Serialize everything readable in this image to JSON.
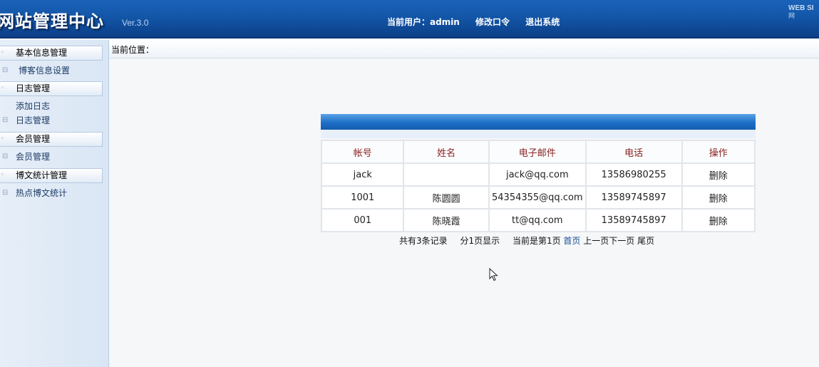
{
  "header": {
    "logo": "网站管理中心",
    "version": "Ver.3.0",
    "current_user_label": "当前用户：admin",
    "change_password": "修改口令",
    "logout": "退出系统",
    "brand_line1": "WEB SI",
    "brand_line2": "网"
  },
  "sidebar": {
    "sections": [
      {
        "title": "基本信息管理",
        "items": [
          "博客信息设置"
        ]
      },
      {
        "title": "日志管理",
        "items": [
          "添加日志",
          "日志管理"
        ]
      },
      {
        "title": "会员管理",
        "items": [
          "会员管理"
        ]
      },
      {
        "title": "博文统计管理",
        "items": [
          "热点博文统计"
        ]
      }
    ]
  },
  "location": {
    "label": "当前位置："
  },
  "table": {
    "headers": [
      "帐号",
      "姓名",
      "电子邮件",
      "电话",
      "操作"
    ],
    "rows": [
      [
        "jack",
        "",
        "jack@qq.com",
        "13586980255",
        "删除"
      ],
      [
        "1001",
        "陈圆圆",
        "54354355@qq.com",
        "13589745897",
        "删除"
      ],
      [
        "001",
        "陈晓霞",
        "tt@qq.com",
        "13589745897",
        "删除"
      ]
    ]
  },
  "pager": {
    "total": "共有3条记录",
    "pages": "分1页显示",
    "current": "当前是第1页",
    "first": "首页",
    "prev": "上一页",
    "next": "下一页",
    "last": "尾页"
  },
  "colors": {
    "header_blue": "#1356a8",
    "table_header_text": "#8a2323",
    "link_blue": "#1a4f96"
  }
}
